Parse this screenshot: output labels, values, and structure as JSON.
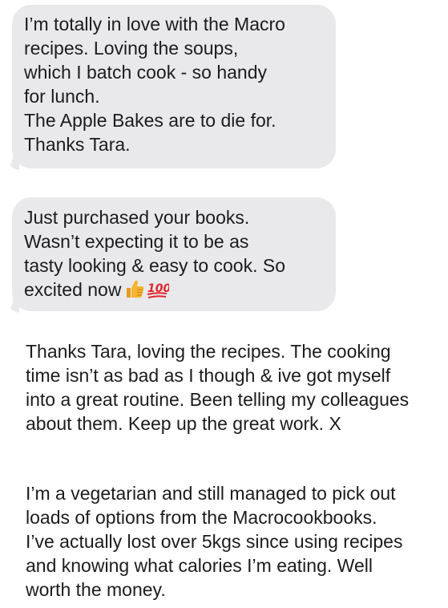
{
  "messages": [
    {
      "lines": [
        "I’m totally in love with the Macro",
        "recipes. Loving the soups,",
        "which I batch cook - so handy",
        "for lunch.",
        "The Apple Bakes are to die for.",
        "Thanks Tara."
      ]
    },
    {
      "lines": [
        "Just purchased your books.",
        "Wasn’t expecting it to be as",
        "tasty looking & easy to cook. So",
        "excited now"
      ],
      "emojis": [
        "thumbs-up-icon",
        "hundred-points-icon"
      ]
    },
    {
      "lines": [
        "Thanks Tara, loving the recipes. The cooking",
        "time isn’t as bad as I though & ive got myself",
        "into a great routine. Been telling my colleagues",
        "about them. Keep up the great work. X"
      ]
    },
    {
      "lines": [
        "I’m a vegetarian and still managed to pick out",
        "loads of options from the Macrocookbooks.",
        "I’ve actually lost over 5kgs since using recipes",
        "and knowing what calories I’m eating. Well",
        "worth the money."
      ]
    }
  ],
  "colors": {
    "bubble_bg": "#e9e9eb",
    "text": "#1c1c1e",
    "background": "#ffffff",
    "thumb": "#f5b52e",
    "hundred": "#e0262b"
  }
}
